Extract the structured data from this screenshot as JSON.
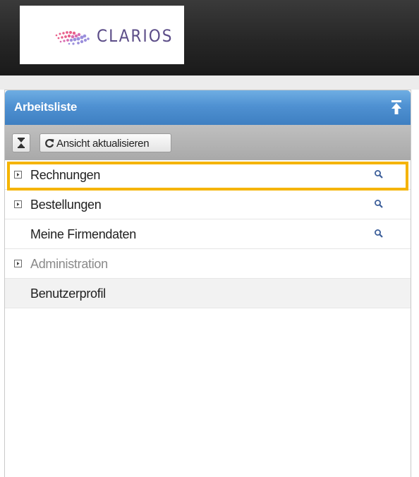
{
  "header": {
    "logo_text": "CLARIOS"
  },
  "panel": {
    "title": "Arbeitsliste",
    "toolbar": {
      "refresh_label": "Ansicht aktualisieren"
    },
    "items": [
      {
        "label": "Rechnungen",
        "expandable": true,
        "search": true,
        "highlighted": true
      },
      {
        "label": "Bestellungen",
        "expandable": true,
        "search": true
      },
      {
        "label": "Meine Firmendaten",
        "expandable": false,
        "search": true
      },
      {
        "label": "Administration",
        "expandable": true,
        "search": false
      },
      {
        "label": "Benutzerprofil",
        "expandable": false,
        "search": false
      }
    ]
  },
  "colors": {
    "header_blue": "#4f91d2",
    "highlight": "#f5b400",
    "logo_purple": "#5c4d88"
  }
}
